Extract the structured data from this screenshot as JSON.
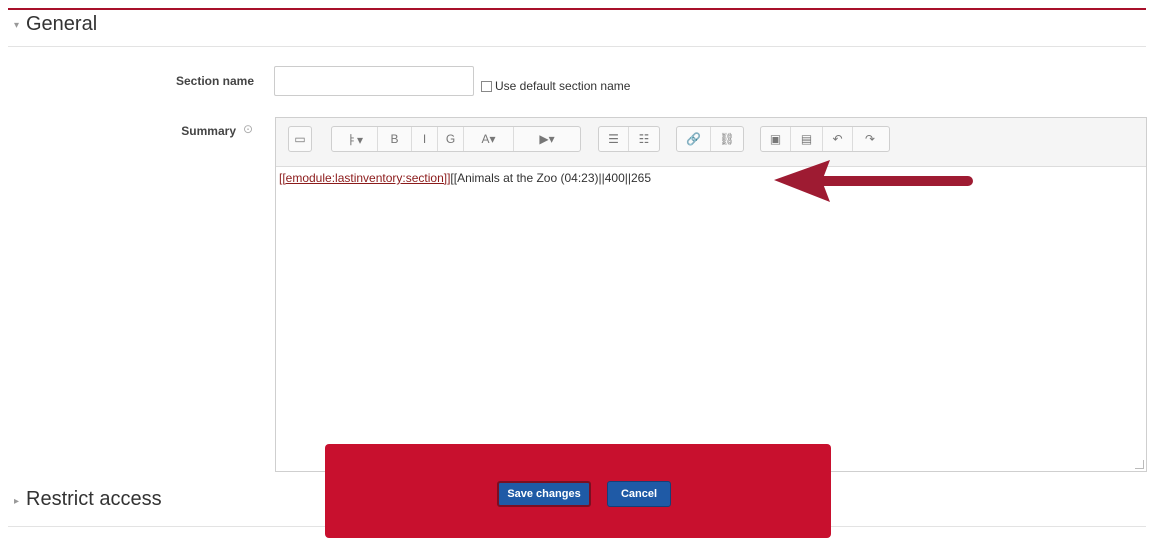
{
  "general": {
    "legend": "General",
    "caret": "▾"
  },
  "section_name": {
    "label": "Section name",
    "value": "",
    "use_default_label": "Use default section name",
    "use_default_checked": false
  },
  "summary": {
    "label": "Summary",
    "help_icon": "⊙",
    "toolbar": {
      "groups": [
        [
          "▭"
        ],
        [
          "ㅑ▾",
          "B",
          "I",
          "G",
          "A▾",
          "▶▾"
        ],
        [
          "☰",
          "☷"
        ],
        [
          "🔗",
          "⛓"
        ],
        [
          "▣",
          "▤",
          "↶",
          "↷"
        ]
      ]
    },
    "content_link": "[[emodule:lastinventory:section]]",
    "content_text": "[[Animals at the Zoo (04:23)||400||265"
  },
  "restrict_access": {
    "legend": "Restrict access",
    "caret": "▸"
  },
  "actions": {
    "save_label": "Save changes",
    "cancel_label": "Cancel"
  },
  "colors": {
    "accent_red": "#c8102e",
    "button_blue": "#1f5aa6",
    "rule_red": "#a8102a"
  }
}
